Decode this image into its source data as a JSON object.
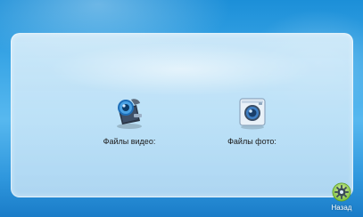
{
  "menu": {
    "video_files_label": "Файлы видео:",
    "photo_files_label": "Файлы фото:"
  },
  "footer": {
    "back_label": "Назад"
  },
  "icons": {
    "video": "video-camera-icon",
    "photo": "photo-camera-icon",
    "back": "gear-back-icon"
  },
  "colors": {
    "background_blue": "#2f97dd",
    "panel": "#d6ecf9",
    "text": "#1b1b1b",
    "back_text": "#ffffff"
  }
}
